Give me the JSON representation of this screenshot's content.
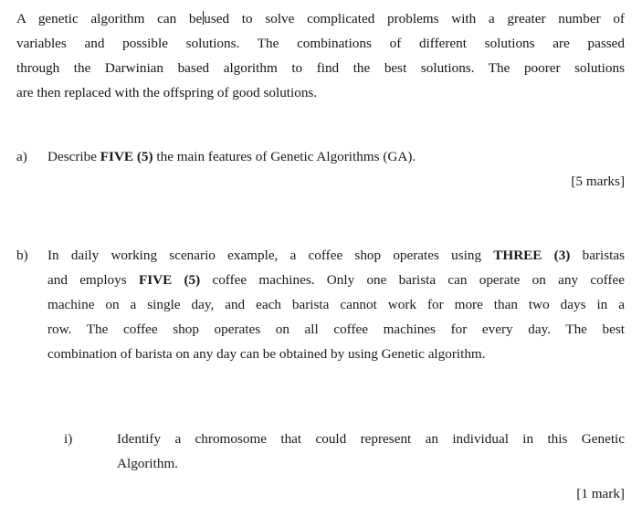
{
  "document": {
    "background_color": "#ffffff",
    "text_color": "#141414"
  },
  "intro": {
    "line1_before_caret": "A genetic algorithm can be",
    "line1_after_caret": "used to solve complicated problems with a greater number of",
    "line2": "variables and possible solutions. The combinations of different solutions are passed",
    "line3": "through the Darwinian based algorithm to find the best solutions. The poorer solutions",
    "line4": "are then replaced with the offspring of good solutions.",
    "full_text": "A genetic algorithm can be used to solve complicated problems with a greater number of variables and possible solutions. The combinations of different solutions are passed through the Darwinian based algorithm to find the best solutions. The poorer solutions are then replaced with the offspring of good solutions."
  },
  "question_a": {
    "label": "a)",
    "text_part1": "Describe ",
    "bold1": "FIVE (5)",
    "text_part2": " the main features of Genetic Algorithms (GA).",
    "full_text": "Describe FIVE (5) the main features of Genetic Algorithms (GA).",
    "marks": "[5 marks]"
  },
  "question_b": {
    "label": "b)",
    "line1_a": "In daily working scenario example, a coffee shop operates using ",
    "line1_bold": "THREE (3)",
    "line1_b": " baristas",
    "line2_a": "and employs ",
    "line2_bold": "FIVE (5)",
    "line2_b": " coffee machines. Only one barista can operate on any coffee",
    "line3": "machine on a single day, and each barista cannot work for more than two days in a",
    "line4": "row. The coffee shop operates on all coffee machines for every day. The best",
    "line5": "combination of barista on any day can be obtained by using Genetic algorithm.",
    "full_text": "In daily working scenario example, a coffee shop operates using THREE (3) baristas and employs FIVE (5) coffee machines. Only one barista can operate on any coffee machine on a single day, and each barista cannot work for more than two days in a row. The coffee shop operates on all coffee machines for every day. The best combination of barista on any day can be obtained by using Genetic algorithm.",
    "sub_i": {
      "label": "i)",
      "line1": "Identify a chromosome that could represent an individual in this Genetic",
      "line2": "Algorithm.",
      "full_text": "Identify a chromosome that could represent an individual in this Genetic Algorithm.",
      "marks": "[1 mark]"
    }
  }
}
